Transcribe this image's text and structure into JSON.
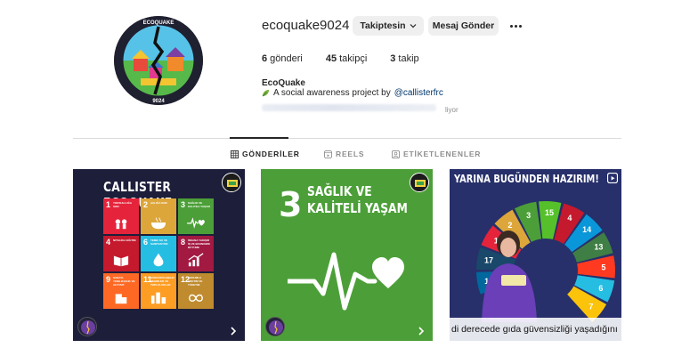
{
  "profile": {
    "username": "ecoquake9024",
    "follow_button_label": "Takiptesin",
    "message_button_label": "Mesaj Gönder",
    "logo_top_text": "ECOQUAKE",
    "logo_bottom_text": "9024",
    "stats": {
      "posts_count": "6",
      "posts_label": "gönderi",
      "followers_count": "45",
      "followers_label": "takipçi",
      "following_count": "3",
      "following_label": "takip"
    },
    "full_name": "EcoQuake",
    "bio_text": "A social awareness project by",
    "bio_mention": "@callisterfrc",
    "blurred_tail": "liyor"
  },
  "tabs": [
    {
      "label": "GÖNDERİLER",
      "active": true
    },
    {
      "label": "REELS",
      "active": false
    },
    {
      "label": "ETİKETLENENLER",
      "active": false
    }
  ],
  "posts": [
    {
      "title": "CALLISTER ECOQUAKE",
      "tiles": [
        {
          "num": "1",
          "label": "Yoksulluğa Son",
          "color": "#e5243b"
        },
        {
          "num": "2",
          "label": "Açlığa Son",
          "color": "#dda63a"
        },
        {
          "num": "3",
          "label": "Sağlık ve Kaliteli Yaşam",
          "color": "#4c9f38"
        },
        {
          "num": "4",
          "label": "Nitelikli Eğitim",
          "color": "#c5192d"
        },
        {
          "num": "6",
          "label": "Temiz Su ve Sanitasyon",
          "color": "#26bde2"
        },
        {
          "num": "8",
          "label": "İnsana Yakışır İş ve Ekonomik Büyüme",
          "color": "#a21942"
        },
        {
          "num": "9",
          "label": "Sanayi, Yenilikçilik ve Altyapı",
          "color": "#fd6925"
        },
        {
          "num": "11",
          "label": "Sürdürülebilir Şehirler ve Topluluklar",
          "color": "#fd9d24"
        },
        {
          "num": "12",
          "label": "Sorumlu Üretim ve Tüketim",
          "color": "#bf8b2e"
        }
      ]
    },
    {
      "number": "3",
      "title_line1": "SAĞLIK VE",
      "title_line2": "KALİTELİ YAŞAM"
    },
    {
      "title": "YARINA BUGÜNDEN HAZIRIM!",
      "caption": "di derecede gıda güvensizliği yaşadığını",
      "wheel_numbers": [
        "16",
        "17",
        "1",
        "2",
        "3",
        "15",
        "4",
        "14",
        "13",
        "5",
        "6",
        "7"
      ],
      "wheel_colors": [
        "#00689d",
        "#19486a",
        "#e5243b",
        "#dda63a",
        "#4c9f38",
        "#56c02b",
        "#c5192d",
        "#0a97d9",
        "#3f7e44",
        "#ff3a21",
        "#26bde2",
        "#fcc30b"
      ]
    }
  ],
  "colors": {
    "link": "#00376b",
    "button_bg": "#efefef",
    "muted": "#8e8e8e"
  }
}
